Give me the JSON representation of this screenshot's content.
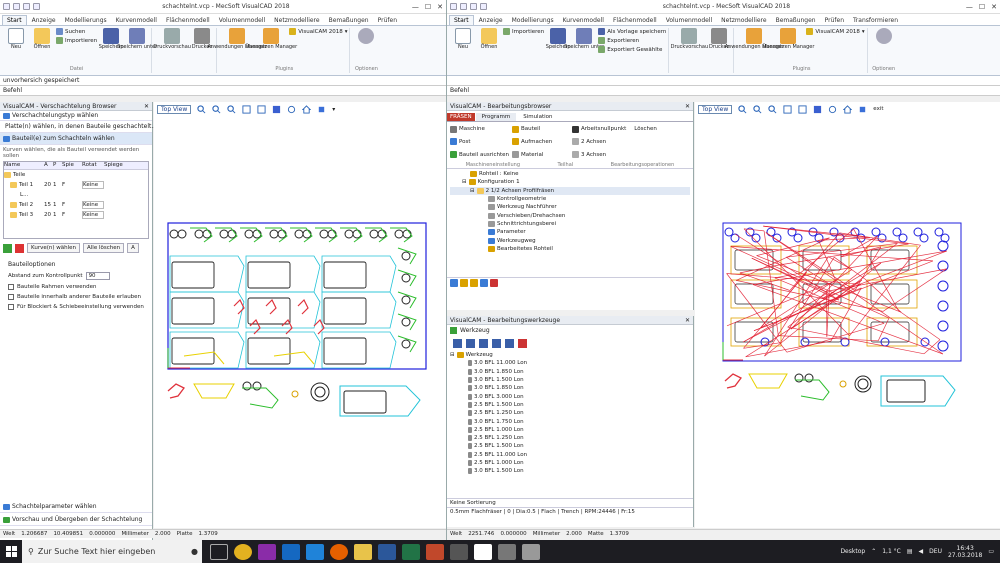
{
  "left_window": {
    "title": "schachtelnt.vcp - MecSoft VisualCAD 2018",
    "tabs": [
      "Start",
      "Anzeige",
      "Modellierungs",
      "Kurvenmodell",
      "Flächenmodell",
      "Volumenmodell",
      "Netzmodelliere",
      "Bemaßungen",
      "Prüfen"
    ],
    "active_tab": "Start",
    "ribbon": {
      "file_new": "Neu",
      "file_open": "Öffnen",
      "search": "Suchen",
      "import": "Importieren",
      "save": "Speichern",
      "save_as": "Speichern unter",
      "print_preview": "Druckvorschau",
      "print": "Drucken",
      "apps_manager": "Anwendungen Manager",
      "translate_manager": "Übersetzen Manager",
      "visualcam": "VisualCAM 2018",
      "options": "Optionen",
      "group_file": "Datei",
      "group_plugins": "Plugins",
      "group_options": "Optionen"
    },
    "info_line": "unvorhersich gespeichert",
    "command_line": "Befehl",
    "panel_title": "VisualCAM - Verschachtelung Browser",
    "steps": [
      "Verschachtelungstyp wählen",
      "Platte(n) wählen, in denen Bauteile geschachtelt...",
      "Bauteil(e) zum Schachteln wählen"
    ],
    "hint": "Kurven wählen, die als Bauteil verwendet werden sollen",
    "table_headers": [
      "Name",
      "A",
      "P",
      "Spie",
      "Rotat",
      "Spiege"
    ],
    "table_rows": [
      {
        "name": "Teile",
        "a": "",
        "p": "",
        "spie": "",
        "rot": "",
        "spiege": ""
      },
      {
        "name": "Teil 1",
        "a": "20",
        "p": "1",
        "spie": "F",
        "rot": "Keine",
        "spiege": ""
      },
      {
        "name": "L...",
        "a": "",
        "p": "",
        "spie": "",
        "rot": "",
        "spiege": ""
      },
      {
        "name": "Teil 2",
        "a": "15",
        "p": "1",
        "spie": "F",
        "rot": "Keine",
        "spiege": ""
      },
      {
        "name": "Teil 3",
        "a": "20",
        "p": "1",
        "spie": "F",
        "rot": "Keine",
        "spiege": ""
      }
    ],
    "btn_select": "Kurve(n) wählen",
    "btn_all_delete": "Alle löschen",
    "btn_a": "A",
    "section_options": "Bauteiloptionen",
    "distance_label": "Abstand zum Kontrollpunkt",
    "distance_value": "90",
    "opt1": "Bauteile Rahmen verwenden",
    "opt2": "Bauteile innerhalb anderer Bauteile erlauben",
    "opt3": "Für Blockiert & Schiebeeinstellung verwenden",
    "footer1": "Schachtelparameter wählen",
    "footer2": "Vorschau und Übergeben der Schachtelung",
    "status": [
      "Welt",
      "1.206687",
      "10.409851",
      "0.000000",
      "Millimeter",
      "2.000",
      "Platte",
      "1.3709"
    ],
    "view_tab": "Top View"
  },
  "right_window": {
    "title": "schachtelnt.vcp - MecSoft VisualCAD 2018",
    "tabs": [
      "Start",
      "Anzeige",
      "Modellierungs",
      "Kurvenmodell",
      "Flächenmodell",
      "Volumenmodell",
      "Netzmodelliere",
      "Bemaßungen",
      "Prüfen",
      "Transformieren"
    ],
    "active_tab": "Start",
    "ribbon": {
      "file_new": "Neu",
      "file_open": "Öffnen",
      "template_save": "Als Vorlage speichern",
      "import": "Importieren",
      "export": "Exportieren",
      "export_selected": "Exportiert Gewählte",
      "save": "Speichern",
      "save_as": "Speichern unter",
      "print_preview": "Druckvorschau",
      "print": "Drucken",
      "apps_manager": "Anwendungen Manager",
      "translate_manager": "Übersetzen Manager",
      "visualcam": "VisualCAM 2018",
      "options": "Optionen",
      "group_plugins": "Plugins",
      "group_options": "Optionen"
    },
    "command_line": "Befehl",
    "panel_title": "VisualCAM - Bearbeitungsbrowser",
    "panel_tabs": [
      "FRÄSEN",
      "Programm",
      "Simulation"
    ],
    "panel_btns": [
      "Maschine",
      "Post",
      "Bauteil ausrichten",
      "Bauteil",
      "Aufmachen",
      "Material",
      "Arbeitsnullpunkt",
      "2 Achsen",
      "3 Achsen",
      "Löschen"
    ],
    "panel_groups": [
      "Maschineneinstellung",
      "Teilhal",
      "Bearbeitungsoperationen"
    ],
    "tree": [
      "Rohteil : Keine",
      "Konfiguration 1",
      "2 1/2 Achsen Profilfräsen",
      "Kontrollgeometrie",
      "Werkzeug Nachführer",
      "Verschieben/Drehachsen",
      "Schnittrichtungsberei",
      "Parameter",
      "Werkzeugweg",
      "Bearbeitetes Rohteil"
    ],
    "tools_panel_title": "VisualCAM - Bearbeitungswerkzeuge",
    "tools_tab": "Werkzeug",
    "tool_root": "Werkzeug",
    "tools": [
      "3.0 BFL 11.000 Lon",
      "3.0 BFL 1.850 Lon",
      "3.0 BFL 1.500 Lon",
      "3.0 BFL 1.850 Lon",
      "3.0 BFL 3.000 Lon",
      "2.5 BFL 1.500 Lon",
      "2.5 BFL 1.250 Lon",
      "3.0 BFL 1.750 Lon",
      "2.5 BFL 1.000 Lon",
      "2.5 BFL 1.250 Lon",
      "2.5 BFL 1.500 Lon",
      "2.5 BFL 11.000 Lon",
      "2.5 BFL 1.000 Lon",
      "3.0 BFL 1.500 Lon"
    ],
    "sort_label": "Keine Sortierung",
    "tool_info": "0.5mm Flachfräser | 0 | Dia:0.5 | Flach | Trench | RPM:24446 | Fr:15",
    "status": [
      "Welt",
      "2251.746",
      "0.000000",
      "Millimeter",
      "2.000",
      "Matte",
      "1.3709"
    ],
    "view_tab": "Top View",
    "view_extra": "exit"
  },
  "taskbar": {
    "search_placeholder": "Zur Suche Text hier eingeben",
    "desktop_label": "Desktop",
    "weather": "1,1 °C",
    "lang": "DEU",
    "time": "16:43",
    "date": "27.03.2018"
  },
  "colors": {
    "ribbon_blue": "#2b579a",
    "plate_blue": "#1f1fdd",
    "part_green": "#2bbd2b",
    "part_yellow": "#e8d100",
    "part_cyan": "#23c3d8",
    "part_red": "#e0323c",
    "toolpath_red": "#e1162a",
    "nest_orange": "#e1a200"
  }
}
